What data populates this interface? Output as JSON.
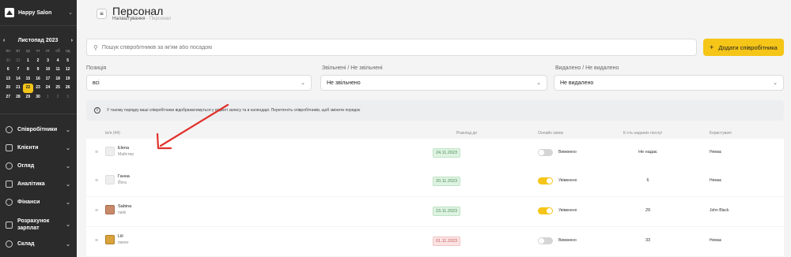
{
  "app": {
    "brand": "Happy Salon"
  },
  "calendar": {
    "month": "Листопад 2023",
    "prev": "‹",
    "next": "›",
    "weekdays": [
      "пн",
      "вт",
      "ср",
      "чт",
      "пт",
      "сб",
      "нд"
    ],
    "weeks": [
      [
        {
          "d": "30",
          "m": true
        },
        {
          "d": "31",
          "m": true
        },
        {
          "d": "1"
        },
        {
          "d": "2"
        },
        {
          "d": "3"
        },
        {
          "d": "4"
        },
        {
          "d": "5"
        }
      ],
      [
        {
          "d": "6"
        },
        {
          "d": "7"
        },
        {
          "d": "8"
        },
        {
          "d": "9"
        },
        {
          "d": "10"
        },
        {
          "d": "11"
        },
        {
          "d": "12"
        }
      ],
      [
        {
          "d": "13"
        },
        {
          "d": "14"
        },
        {
          "d": "15"
        },
        {
          "d": "16"
        },
        {
          "d": "17"
        },
        {
          "d": "18"
        },
        {
          "d": "19"
        }
      ],
      [
        {
          "d": "20"
        },
        {
          "d": "21"
        },
        {
          "d": "22",
          "today": true
        },
        {
          "d": "23"
        },
        {
          "d": "24"
        },
        {
          "d": "25"
        },
        {
          "d": "26"
        }
      ],
      [
        {
          "d": "27"
        },
        {
          "d": "28"
        },
        {
          "d": "29"
        },
        {
          "d": "30"
        },
        {
          "d": "1",
          "m": true
        },
        {
          "d": "2",
          "m": true
        },
        {
          "d": "3",
          "m": true
        }
      ]
    ]
  },
  "nav": [
    {
      "label": "Співробітники",
      "icon": "users-icon"
    },
    {
      "label": "Клієнти",
      "icon": "clients-icon"
    },
    {
      "label": "Огляд",
      "icon": "overview-icon"
    },
    {
      "label": "Аналітика",
      "icon": "analytics-icon"
    },
    {
      "label": "Фінанси",
      "icon": "finance-icon"
    },
    {
      "label": "Розрахунок зарплат",
      "icon": "payroll-icon"
    },
    {
      "label": "Склад",
      "icon": "warehouse-icon"
    }
  ],
  "header": {
    "title": "Персонал",
    "breadcrumb_parent": "Налаштування",
    "breadcrumb_sep": "·",
    "breadcrumb_current": "Персонал"
  },
  "search": {
    "placeholder": "Пошук співробітників за ім'ям або посадою",
    "value": ""
  },
  "add_button": {
    "label": "Додати співробітника"
  },
  "filters": [
    {
      "label": "Позиція",
      "value": "всі"
    },
    {
      "label": "Звільнені / Не звільнені",
      "value": "Не звільнено"
    },
    {
      "label": "Видалено / Не видалено",
      "value": "Не видалено"
    }
  ],
  "info_text": "У такому порядку ваші співробітники відображатимуться у віджеті запису та в календарі. Перетягніть співробітників, щоб змінити порядок",
  "table": {
    "headers": {
      "name": "Ім'я (44)",
      "schedule": "Розклад до",
      "online": "Онлайн запис",
      "services": "К-сть наданих послуг",
      "user": "Користувачі"
    },
    "rows": [
      {
        "name": "Elena",
        "role": "Майстер",
        "schedule": "24.11.2023",
        "schedule_status": "green",
        "online_on": false,
        "online_label": "Вимкнено",
        "services": "Не надає",
        "user": "Немає",
        "avatar": "placeholder"
      },
      {
        "name": "Ганна",
        "role": "Йога",
        "schedule": "20.11.2023",
        "schedule_status": "green",
        "online_on": true,
        "online_label": "Увімкнено",
        "services": "6",
        "user": "Немає",
        "avatar": "placeholder"
      },
      {
        "name": "Sabina",
        "role": "nails",
        "schedule": "23.11.2023",
        "schedule_status": "green",
        "online_on": true,
        "online_label": "Увімкнено",
        "services": "29",
        "user": "John Black",
        "avatar": "photo"
      },
      {
        "name": "Lili",
        "role": "owner",
        "schedule": "01.11.2023",
        "schedule_status": "red",
        "online_on": false,
        "online_label": "Вимкнено",
        "services": "33",
        "user": "Немає",
        "avatar": "photo2"
      }
    ]
  },
  "colors": {
    "accent": "#f5c518",
    "sidebar": "#2b2b2b",
    "annotation": "#e0322b"
  }
}
